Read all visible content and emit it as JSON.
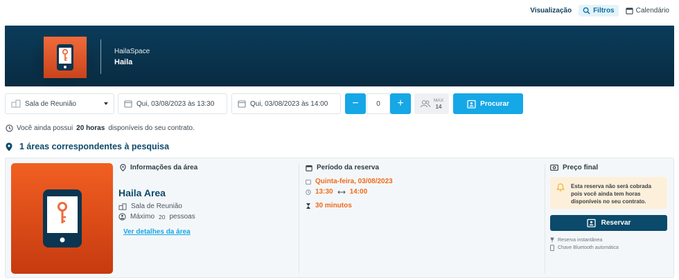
{
  "toolbar": {
    "visualizacao": "Visualização",
    "filtros": "Filtros",
    "calendario": "Calendário"
  },
  "banner": {
    "brand": "HailaSpace",
    "space": "Haila"
  },
  "search": {
    "room_type": "Sala de Reunião",
    "start": "Qui, 03/08/2023 às 13:30",
    "end": "Qui, 03/08/2023 às 14:00",
    "minus": "−",
    "count": "0",
    "plus": "+",
    "max_label": "MAX",
    "max_value": "14",
    "search_label": "Procurar"
  },
  "info": {
    "hours_prefix": "Você ainda possui",
    "hours_bold": "20 horas",
    "hours_suffix": "disponíveis do seu contrato."
  },
  "results": {
    "title": "1 áreas correspondentes à pesquisa"
  },
  "card": {
    "info_title": "Informações da área",
    "area_name": "Haila Area",
    "room_type": "Sala de Reunião",
    "capacity_prefix": "Máximo",
    "capacity_value": "20",
    "capacity_suffix": "pessoas",
    "details_link": "Ver detalhes da área",
    "period_title": "Período da reserva",
    "date": "Quinta-feira, 03/08/2023",
    "time_start": "13:30",
    "time_end": "14:00",
    "duration": "30 minutos",
    "price_title": "Preço final",
    "notice": "Esta reserva não será cobrada pois você ainda tem horas disponíveis no seu contrato.",
    "reserve_label": "Reservar",
    "feature_1": "Reserva instantânea",
    "feature_2": "Chave Bluetooth automática"
  },
  "colors": {
    "primary": "#16a7e6",
    "navy": "#0b4a6b",
    "orange": "#f06a1a",
    "banner": "#0b3c5a"
  }
}
